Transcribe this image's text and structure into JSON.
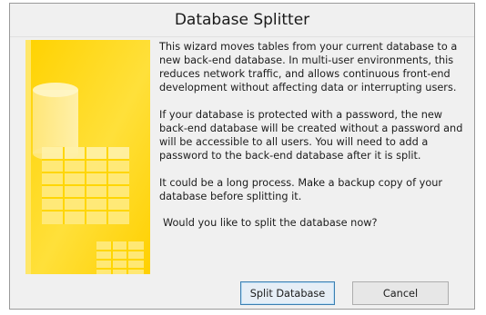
{
  "window": {
    "title": "Database Splitter"
  },
  "body": {
    "paragraph_1": "This wizard moves tables from your current database to a new back-end database. In multi-user environments, this reduces network traffic, and allows continuous front-end development without affecting data or interrupting users.",
    "paragraph_2": "If your database is protected with a password, the new back-end database will be created without a password and will be accessible to all users.  You will need to add a password to the back-end database after it is split.",
    "paragraph_3": "It could be a long process. Make a backup copy of your database before splitting it.",
    "question": "Would you like to split the database now?"
  },
  "buttons": {
    "split_label": "Split Database",
    "cancel_label": "Cancel"
  },
  "colors": {
    "art_yellow": "#ffd500",
    "art_yellow_light": "#ffe98a",
    "focus_border": "#3c7fb1"
  },
  "icons": {
    "art": "database-table-illustration"
  }
}
